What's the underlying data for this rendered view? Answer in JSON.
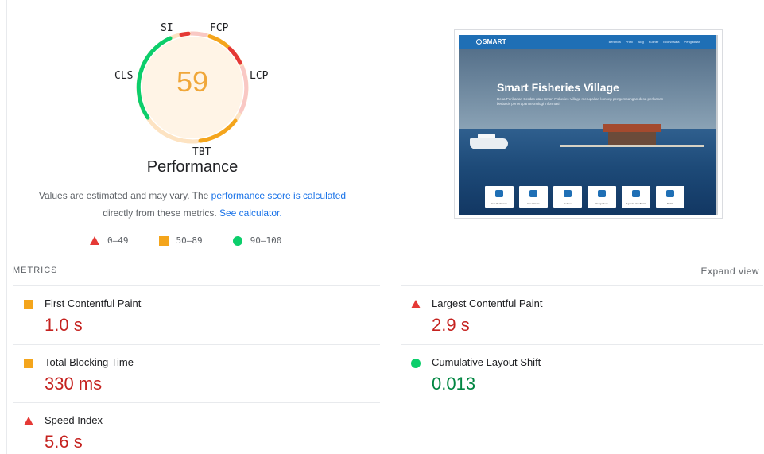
{
  "gauge": {
    "score": "59",
    "score_color": "#f0a73a",
    "labels": {
      "si": "SI",
      "fcp": "FCP",
      "lcp": "LCP",
      "cls": "CLS",
      "tbt": "TBT"
    }
  },
  "performance_title": "Performance",
  "estimate": {
    "text_before": "Values are estimated and may vary. The ",
    "score_link": "performance score is calculated",
    "text_middle": "directly from these metrics. ",
    "calculator_link": "See calculator."
  },
  "legend": [
    {
      "icon": "triangle-icon",
      "label": "0–49",
      "color": "#e53935"
    },
    {
      "icon": "square-icon",
      "label": "50–89",
      "color": "#f4a51c"
    },
    {
      "icon": "circle-icon",
      "label": "90–100",
      "color": "#0cce6b"
    }
  ],
  "preview": {
    "logo": "SMART",
    "menu": [
      "Beranda",
      "Profil",
      "Blog",
      "Kuliner",
      "Eco Wisata",
      "Pengaduan"
    ],
    "hero_title": "Smart Fisheries Village",
    "hero_subtitle": "Desa Perikanan Cerdas atau Smart Fisheries Village merupakan konsep pengembangan desa perikanan berbasis penerapan teknologi informasi",
    "cards": [
      "Eco Perikanan",
      "Eco Wisata",
      "Kuliner",
      "Pengaduan",
      "Agenda dan Berita",
      "Profile"
    ]
  },
  "metrics_header": "METRICS",
  "expand_view": "Expand view",
  "metrics": {
    "fcp": {
      "name": "First Contentful Paint",
      "value": "1.0 s",
      "icon": "square-icon"
    },
    "lcp": {
      "name": "Largest Contentful Paint",
      "value": "2.9 s",
      "icon": "triangle-icon"
    },
    "tbt": {
      "name": "Total Blocking Time",
      "value": "330 ms",
      "icon": "square-icon"
    },
    "cls": {
      "name": "Cumulative Layout Shift",
      "value": "0.013",
      "icon": "circle-icon"
    },
    "si": {
      "name": "Speed Index",
      "value": "5.6 s",
      "icon": "triangle-icon"
    }
  },
  "colors": {
    "fail": "#c5221f",
    "average": "#f4a51c",
    "pass": "#018642",
    "link": "#1a73e8"
  }
}
